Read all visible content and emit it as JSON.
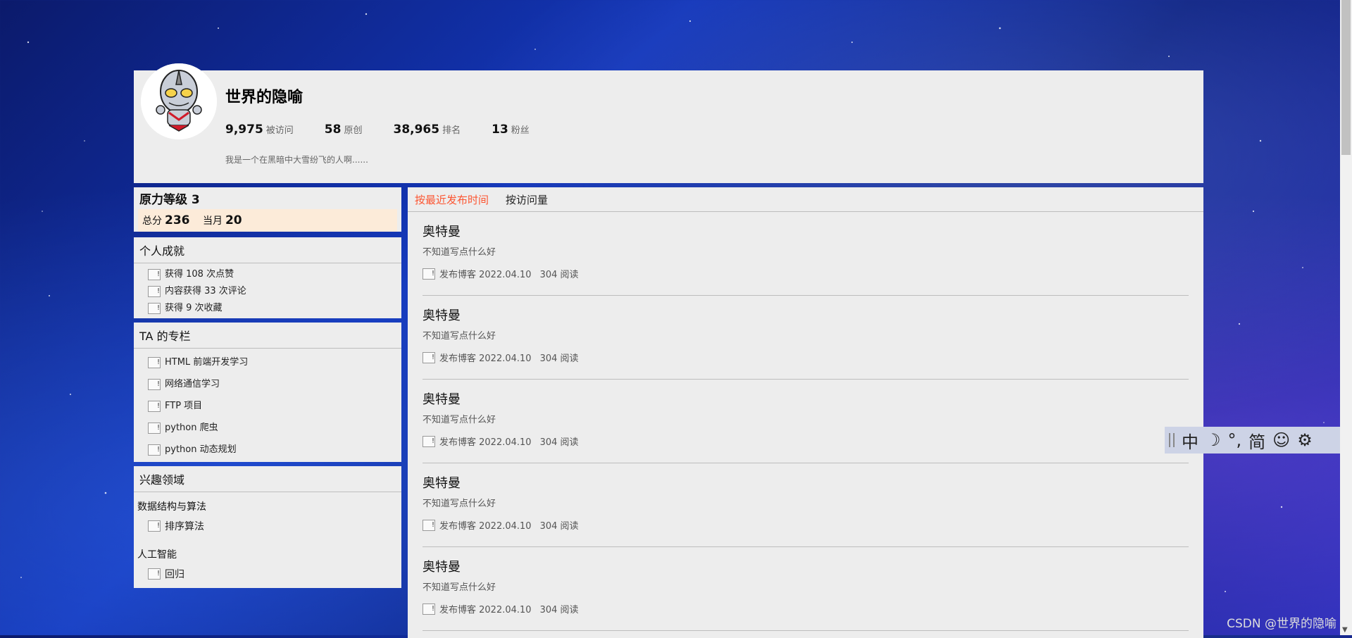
{
  "profile": {
    "name": "世界的隐喻",
    "bio": "我是一个在黑暗中大雪纷飞的人啊......",
    "stats": [
      {
        "num": "9,975",
        "label": "被访问"
      },
      {
        "num": "58",
        "label": "原创"
      },
      {
        "num": "38,965",
        "label": "排名"
      },
      {
        "num": "13",
        "label": "粉丝"
      }
    ]
  },
  "force": {
    "title": "原力等级 3",
    "total_label": "总分",
    "total_value": "236",
    "month_label": "当月",
    "month_value": "20"
  },
  "achievements": {
    "title": "个人成就",
    "items": [
      "获得 108 次点赞",
      "内容获得 33 次评论",
      "获得 9 次收藏"
    ]
  },
  "columns": {
    "title": "TA 的专栏",
    "items": [
      "HTML 前端开发学习",
      "网络通信学习",
      "FTP 项目",
      "python 爬虫",
      "python 动态规划"
    ]
  },
  "interests": {
    "title": "兴趣领域",
    "groups": [
      {
        "category": "数据结构与算法",
        "items": [
          "排序算法"
        ]
      },
      {
        "category": "人工智能",
        "items": [
          "回归"
        ]
      }
    ]
  },
  "broken_image_glyph": "!",
  "tabs": [
    {
      "label": "按最近发布时间",
      "active": true
    },
    {
      "label": "按访问量",
      "active": false
    }
  ],
  "posts": [
    {
      "title": "奥特曼",
      "desc": "不知道写点什么好",
      "meta": "发布博客 2022.04.10",
      "reads": "304 阅读"
    },
    {
      "title": "奥特曼",
      "desc": "不知道写点什么好",
      "meta": "发布博客 2022.04.10",
      "reads": "304 阅读"
    },
    {
      "title": "奥特曼",
      "desc": "不知道写点什么好",
      "meta": "发布博客 2022.04.10",
      "reads": "304 阅读"
    },
    {
      "title": "奥特曼",
      "desc": "不知道写点什么好",
      "meta": "发布博客 2022.04.10",
      "reads": "304 阅读"
    },
    {
      "title": "奥特曼",
      "desc": "不知道写点什么好",
      "meta": "发布博客 2022.04.10",
      "reads": "304 阅读"
    }
  ],
  "ime": {
    "chars": [
      "中",
      "☽",
      "°,",
      "简",
      "☺",
      "⚙"
    ]
  },
  "watermark": "CSDN @世界的隐喻",
  "colors": {
    "accent": "#fc5531",
    "card": "#ededed",
    "force_box": "#fcebd9"
  }
}
